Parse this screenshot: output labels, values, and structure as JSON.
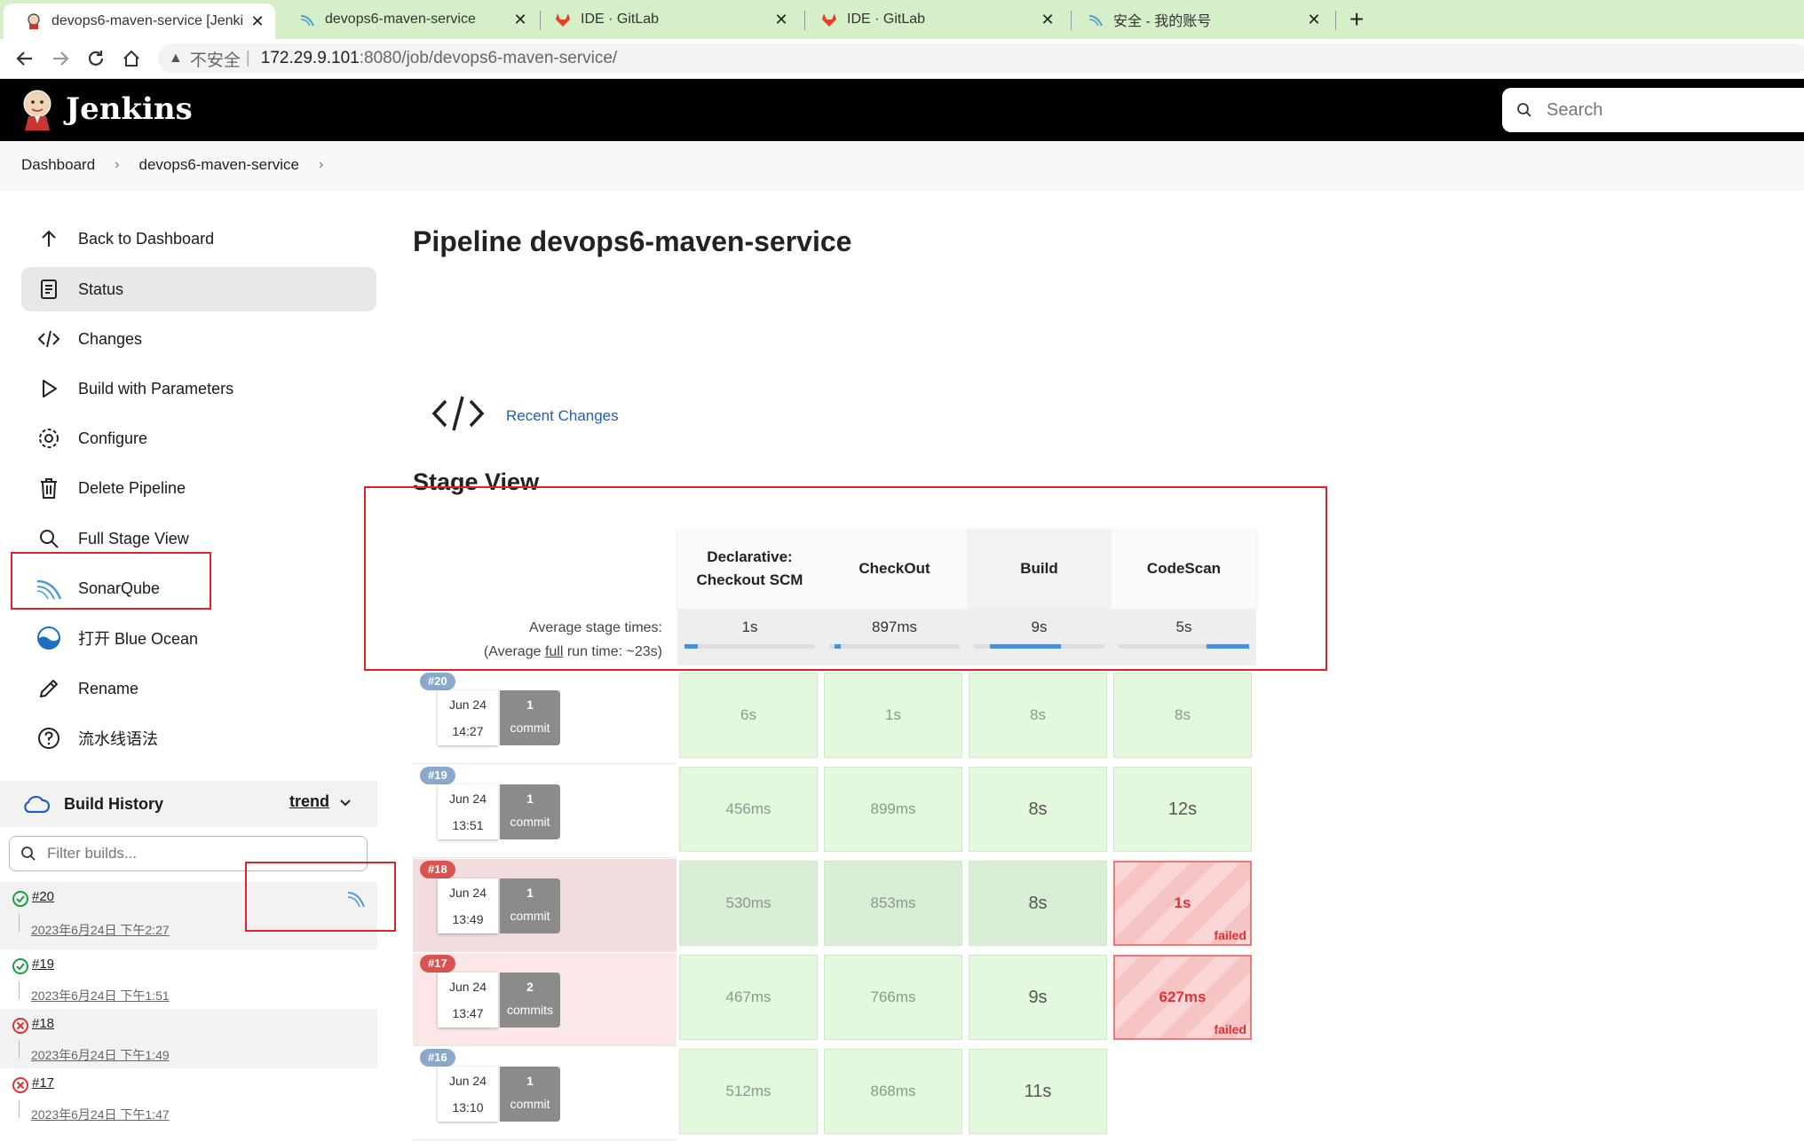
{
  "browser": {
    "tabs": [
      {
        "title": "devops6-maven-service [Jenki",
        "active": true
      },
      {
        "title": "devops6-maven-service"
      },
      {
        "title": "IDE · GitLab"
      },
      {
        "title": "IDE · GitLab"
      },
      {
        "title": "安全 - 我的账号"
      }
    ],
    "url_security": "不安全",
    "url_host": "172.29.9.101",
    "url_path": ":8080/job/devops6-maven-service/"
  },
  "header": {
    "title": "Jenkins",
    "search_placeholder": "Search"
  },
  "breadcrumb": [
    "Dashboard",
    "devops6-maven-service"
  ],
  "sidebar": {
    "items": [
      {
        "label": "Back to Dashboard",
        "icon": "arrow-up-icon"
      },
      {
        "label": "Status",
        "icon": "status-icon",
        "active": true
      },
      {
        "label": "Changes",
        "icon": "code-icon"
      },
      {
        "label": "Build with Parameters",
        "icon": "play-icon"
      },
      {
        "label": "Configure",
        "icon": "gear-icon"
      },
      {
        "label": "Delete Pipeline",
        "icon": "trash-icon"
      },
      {
        "label": "Full Stage View",
        "icon": "search-icon"
      },
      {
        "label": "SonarQube",
        "icon": "sonarqube-icon"
      },
      {
        "label": "打开 Blue Ocean",
        "icon": "blue-ocean-icon"
      },
      {
        "label": "Rename",
        "icon": "pencil-icon"
      },
      {
        "label": "流水线语法",
        "icon": "help-icon"
      }
    ]
  },
  "build_history": {
    "title": "Build History",
    "trend": "trend",
    "filter_placeholder": "Filter builds...",
    "builds": [
      {
        "num": "#20",
        "date": "2023年6月24日 下午2:27",
        "status": "success"
      },
      {
        "num": "#19",
        "date": "2023年6月24日 下午1:51",
        "status": "success"
      },
      {
        "num": "#18",
        "date": "2023年6月24日 下午1:49",
        "status": "failed"
      },
      {
        "num": "#17",
        "date": "2023年6月24日 下午1:47",
        "status": "failed"
      }
    ]
  },
  "main": {
    "title": "Pipeline devops6-maven-service",
    "recent_changes": "Recent Changes",
    "stage_view_title": "Stage View",
    "avg_label_1": "Average stage times:",
    "avg_label_2_pre": "(Average ",
    "avg_label_2_link": "full",
    "avg_label_2_post": " run time: ~23s)"
  },
  "stages": [
    {
      "name": "Declarative: Checkout SCM",
      "avg": "1s",
      "avg_fraction": 0.1
    },
    {
      "name": "CheckOut",
      "avg": "897ms",
      "avg_fraction": 0.05
    },
    {
      "name": "Build",
      "avg": "9s",
      "avg_fraction": 0.55
    },
    {
      "name": "CodeScan",
      "avg": "5s",
      "avg_fraction": 0.33
    }
  ],
  "runs": [
    {
      "badge": "#20",
      "date": "Jun 24",
      "time": "14:27",
      "commits": "1",
      "commit_label": "commit",
      "status": "success",
      "cells": [
        {
          "v": "6s"
        },
        {
          "v": "1s"
        },
        {
          "v": "8s"
        },
        {
          "v": "8s"
        }
      ]
    },
    {
      "badge": "#19",
      "date": "Jun 24",
      "time": "13:51",
      "commits": "1",
      "commit_label": "commit",
      "status": "success",
      "cells": [
        {
          "v": "456ms"
        },
        {
          "v": "899ms"
        },
        {
          "v": "8s",
          "dark": true
        },
        {
          "v": "12s",
          "dark": true
        }
      ]
    },
    {
      "badge": "#18",
      "date": "Jun 24",
      "time": "13:49",
      "commits": "1",
      "commit_label": "commit",
      "status": "failed",
      "cells": [
        {
          "v": "530ms"
        },
        {
          "v": "853ms"
        },
        {
          "v": "8s",
          "dark": true
        },
        {
          "v": "1s",
          "fail": true
        }
      ]
    },
    {
      "badge": "#17",
      "date": "Jun 24",
      "time": "13:47",
      "commits": "2",
      "commit_label": "commits",
      "status": "failed",
      "cells": [
        {
          "v": "467ms"
        },
        {
          "v": "766ms"
        },
        {
          "v": "9s",
          "dark": true
        },
        {
          "v": "627ms",
          "fail": true
        }
      ]
    },
    {
      "badge": "#16",
      "date": "Jun 24",
      "time": "13:10",
      "commits": "1",
      "commit_label": "commit",
      "status": "success",
      "cells": [
        {
          "v": "512ms"
        },
        {
          "v": "868ms"
        },
        {
          "v": "11s",
          "dark": true
        }
      ]
    }
  ],
  "failed_label": "failed",
  "colors": {
    "accent_link": "#1f5fbf",
    "success_green": "#1a9e3f",
    "fail_red": "#d33",
    "annotation_red": "#e0232a",
    "badge_blue": "#8aa8cc",
    "badge_red": "#d9534f"
  }
}
